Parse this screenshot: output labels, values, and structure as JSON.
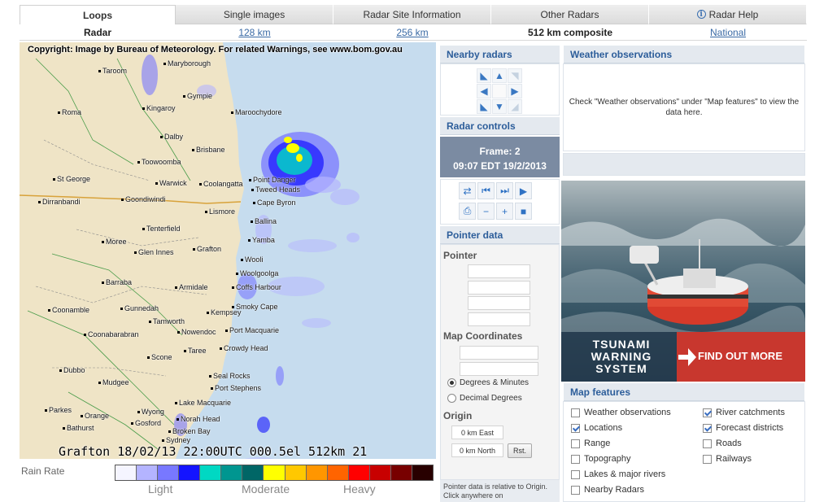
{
  "tabs": [
    {
      "label": "Loops",
      "active": true
    },
    {
      "label": "Single images"
    },
    {
      "label": "Radar Site Information"
    },
    {
      "label": "Other Radars"
    },
    {
      "label": "Radar Help"
    }
  ],
  "subtabs": {
    "radar": "Radar",
    "km128": "128 km",
    "km256": "256 km",
    "km512": "512 km composite",
    "national": "National"
  },
  "radar": {
    "copyright": "Copyright: Image by Bureau of Meteorology. For related Warnings, see www.bom.gov.au",
    "footer": "Grafton 18/02/13 22:00UTC 000.5el 512km 21",
    "places": {
      "taroom": "Taroom",
      "maryborough": "Maryborough",
      "gympie": "Gympie",
      "roma": "Roma",
      "kingaroy": "Kingaroy",
      "maroochydore": "Maroochydore",
      "dalby": "Dalby",
      "brisbane": "Brisbane",
      "toowoomba": "Toowoomba",
      "stgeorge": "St George",
      "warwick": "Warwick",
      "coolangatta": "Coolangatta",
      "pointdanger": "Point Danger",
      "tweedheads": "Tweed Heads",
      "dirranbandi": "Dirranbandi",
      "goondiwindi": "Goondiwindi",
      "capebyron": "Cape Byron",
      "lismore": "Lismore",
      "ballina": "Ballina",
      "tenterfield": "Tenterfield",
      "moree": "Moree",
      "yamba": "Yamba",
      "grafton": "Grafton",
      "glenInnes": "Glen Innes",
      "wooli": "Wooli",
      "woolgoolga": "Woolgoolga",
      "barraba": "Barraba",
      "armidale": "Armidale",
      "coffsharbour": "Coffs Harbour",
      "coonamble": "Coonamble",
      "gunnedah": "Gunnedah",
      "kempsey": "Kempsey",
      "smokycape": "Smoky Cape",
      "tamworth": "Tamworth",
      "coonabarabran": "Coonabarabran",
      "nowendoc": "Nowendoc",
      "portmacquarie": "Port Macquarie",
      "taree": "Taree",
      "crowdyhead": "Crowdy Head",
      "scone": "Scone",
      "dubbo": "Dubbo",
      "mudgee": "Mudgee",
      "sealrocks": "Seal Rocks",
      "portstephens": "Port Stephens",
      "lakemacquarie": "Lake Macquarie",
      "parkes": "Parkes",
      "wyong": "Wyong",
      "orange": "Orange",
      "norahhead": "Norah Head",
      "gosford": "Gosford",
      "bathurst": "Bathurst",
      "brokenbay": "Broken Bay",
      "sydney": "Sydney"
    }
  },
  "legend": {
    "title": "Rain Rate",
    "colors": [
      "#f5f5ff",
      "#b4b4ff",
      "#7878ff",
      "#1414ff",
      "#00d8c3",
      "#009690",
      "#006666",
      "#ffff00",
      "#ffc800",
      "#ff9600",
      "#ff6400",
      "#ff0000",
      "#c80000",
      "#780000",
      "#280000"
    ],
    "light": "Light",
    "moderate": "Moderate",
    "heavy": "Heavy"
  },
  "nearby": {
    "title": "Nearby radars",
    "arrows": [
      "◣",
      "▲",
      "◥",
      "◀",
      "",
      "▶",
      "◣",
      "▼",
      "◢"
    ]
  },
  "controls": {
    "title": "Radar controls",
    "frame": "Frame: 2",
    "time": "09:07 EDT 19/2/2013"
  },
  "pointer": {
    "title": "Pointer data",
    "pointer_label": "Pointer",
    "map_coords_label": "Map Coordinates",
    "degrees_minutes": "Degrees & Minutes",
    "decimal_degrees": "Decimal Degrees",
    "origin_label": "Origin",
    "east": "0 km East",
    "north": "0 km North",
    "reset": "Rst.",
    "note": "Pointer data is relative to Origin. Click anywhere on"
  },
  "weather_obs": {
    "title": "Weather observations",
    "text": "Check \"Weather observations\" under \"Map features\" to view the data here."
  },
  "ad": {
    "line1": "TSUNAMI",
    "line2": "WARNING",
    "line3": "SYSTEM",
    "cta": "FIND OUT MORE"
  },
  "map_features": {
    "title": "Map features",
    "left": [
      {
        "label": "Weather observations",
        "checked": false
      },
      {
        "label": "Locations",
        "checked": true
      },
      {
        "label": "Range",
        "checked": false
      },
      {
        "label": "Topography",
        "checked": false
      },
      {
        "label": "Lakes & major rivers",
        "checked": false
      },
      {
        "label": "Nearby Radars",
        "checked": false
      }
    ],
    "right": [
      {
        "label": "River catchments",
        "checked": true
      },
      {
        "label": "Forecast districts",
        "checked": true
      },
      {
        "label": "Roads",
        "checked": false
      },
      {
        "label": "Railways",
        "checked": false
      }
    ]
  }
}
